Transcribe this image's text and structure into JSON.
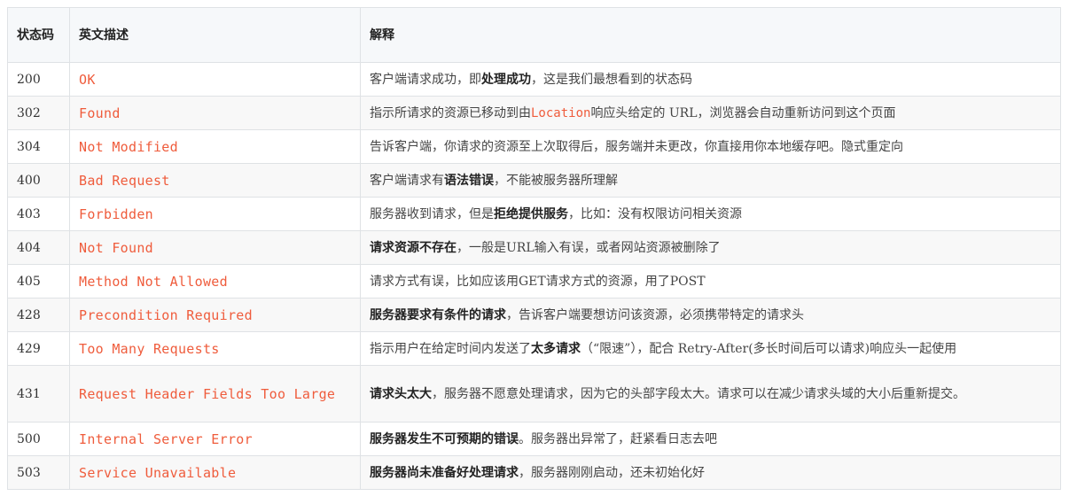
{
  "headers": {
    "code": "状态码",
    "desc": "英文描述",
    "expl": "解释"
  },
  "rows": [
    {
      "code": "200",
      "desc": "OK",
      "expl": [
        {
          "t": "客户端请求成功，即"
        },
        {
          "t": "处理成功",
          "b": true
        },
        {
          "t": "，这是我们最想看到的状态码"
        }
      ]
    },
    {
      "code": "302",
      "desc": "Found",
      "expl": [
        {
          "t": "指示所请求的资源已移动到由"
        },
        {
          "t": "Location",
          "m": true
        },
        {
          "t": "响应头给定的 URL，浏览器会自动重新访问到这个页面"
        }
      ]
    },
    {
      "code": "304",
      "desc": "Not Modified",
      "expl": [
        {
          "t": "告诉客户端，你请求的资源至上次取得后，服务端并未更改，你直接用你本地缓存吧。隐式重定向"
        }
      ]
    },
    {
      "code": "400",
      "desc": "Bad Request",
      "expl": [
        {
          "t": "客户端请求有"
        },
        {
          "t": "语法错误",
          "b": true
        },
        {
          "t": "，不能被服务器所理解"
        }
      ]
    },
    {
      "code": "403",
      "desc": "Forbidden",
      "expl": [
        {
          "t": "服务器收到请求，但是"
        },
        {
          "t": "拒绝提供服务",
          "b": true
        },
        {
          "t": "，比如：没有权限访问相关资源"
        }
      ]
    },
    {
      "code": "404",
      "desc": "Not Found",
      "expl": [
        {
          "t": "请求资源不存在",
          "b": true
        },
        {
          "t": "，一般是URL输入有误，或者网站资源被删除了"
        }
      ]
    },
    {
      "code": "405",
      "desc": "Method Not Allowed",
      "expl": [
        {
          "t": "请求方式有误，比如应该用GET请求方式的资源，用了POST"
        }
      ]
    },
    {
      "code": "428",
      "desc": "Precondition Required",
      "expl": [
        {
          "t": "服务器要求有条件的请求",
          "b": true
        },
        {
          "t": "，告诉客户端要想访问该资源，必须携带特定的请求头"
        }
      ]
    },
    {
      "code": "429",
      "desc": "Too Many Requests",
      "expl": [
        {
          "t": "指示用户在给定时间内发送了"
        },
        {
          "t": "太多请求",
          "b": true
        },
        {
          "t": "（“限速”），配合 Retry-After(多长时间后可以请求)响应头一起使用"
        }
      ]
    },
    {
      "code": "431",
      "desc": "Request Header Fields Too Large",
      "tall": true,
      "expl": [
        {
          "t": "请求头太大",
          "b": true
        },
        {
          "t": "，服务器不愿意处理请求，因为它的头部字段太大。请求可以在减少请求头域的大小后重新提交。"
        }
      ]
    },
    {
      "code": "500",
      "desc": "Internal Server Error",
      "expl": [
        {
          "t": "服务器发生不可预期的错误",
          "b": true
        },
        {
          "t": "。服务器出异常了，赶紧看日志去吧"
        }
      ]
    },
    {
      "code": "503",
      "desc": "Service Unavailable",
      "expl": [
        {
          "t": "服务器尚未准备好处理请求",
          "b": true
        },
        {
          "t": "，服务器刚刚启动，还未初始化好"
        }
      ]
    }
  ]
}
